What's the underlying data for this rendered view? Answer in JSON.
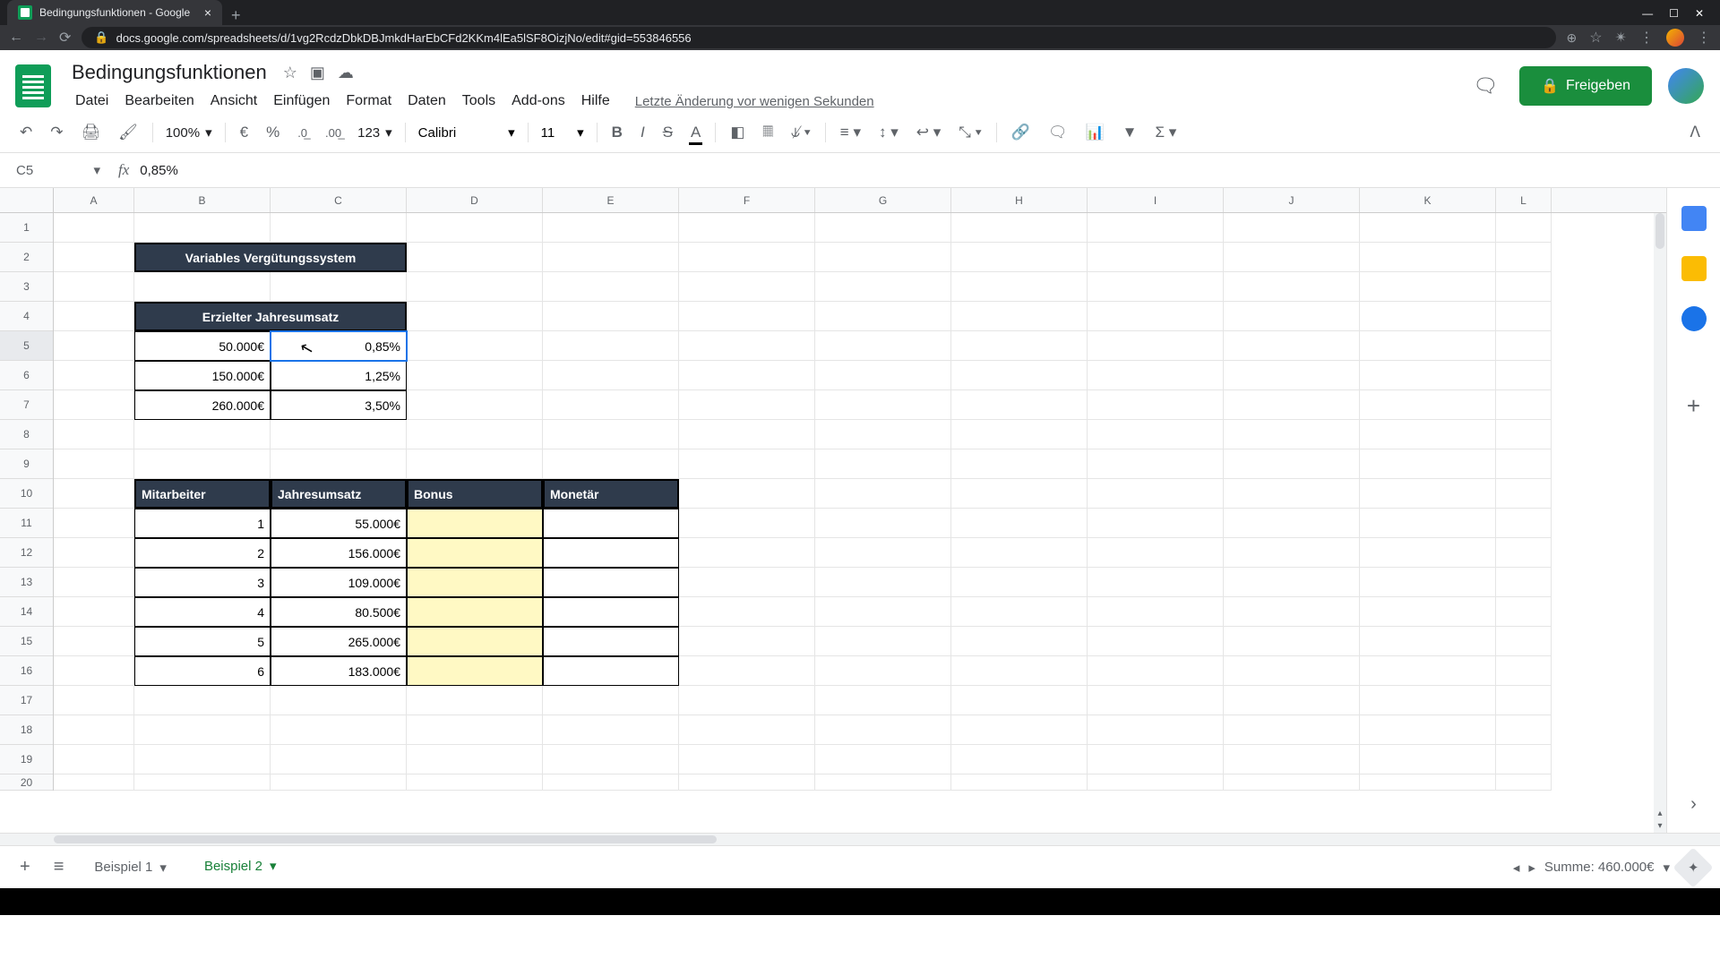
{
  "browser": {
    "tab_title": "Bedingungsfunktionen - Google",
    "url": "docs.google.com/spreadsheets/d/1vg2RcdzDbkDBJmkdHarEbCFd2KKm4lEa5lSF8OizjNo/edit#gid=553846556"
  },
  "doc": {
    "title": "Bedingungsfunktionen",
    "last_edit": "Letzte Änderung vor wenigen Sekunden",
    "share_label": "Freigeben"
  },
  "menu": {
    "file": "Datei",
    "edit": "Bearbeiten",
    "view": "Ansicht",
    "insert": "Einfügen",
    "format": "Format",
    "data": "Daten",
    "tools": "Tools",
    "addons": "Add-ons",
    "help": "Hilfe"
  },
  "toolbar": {
    "zoom": "100%",
    "currency": "€",
    "percent": "%",
    "dec_dec": ".0",
    "inc_dec": ".00",
    "num_format": "123",
    "font": "Calibri",
    "size": "11"
  },
  "formula": {
    "name_box": "C5",
    "value": "0,85%"
  },
  "columns": [
    "A",
    "B",
    "C",
    "D",
    "E",
    "F",
    "G",
    "H",
    "I",
    "J",
    "K",
    "L"
  ],
  "rows": [
    "1",
    "2",
    "3",
    "4",
    "5",
    "6",
    "7",
    "8",
    "9",
    "10",
    "11",
    "12",
    "13",
    "14",
    "15",
    "16",
    "17",
    "18",
    "19",
    "20"
  ],
  "sheet": {
    "B2C2_title": "Variables Vergütungssystem",
    "B4C4_title": "Erzielter Jahresumsatz",
    "tiers": [
      {
        "amount": "50.000€",
        "pct": "0,85%"
      },
      {
        "amount": "150.000€",
        "pct": "1,25%"
      },
      {
        "amount": "260.000€",
        "pct": "3,50%"
      }
    ],
    "emp_headers": {
      "mitarbeiter": "Mitarbeiter",
      "jahresumsatz": "Jahresumsatz",
      "bonus": "Bonus",
      "monetar": "Monetär"
    },
    "employees": [
      {
        "n": "1",
        "rev": "55.000€"
      },
      {
        "n": "2",
        "rev": "156.000€"
      },
      {
        "n": "3",
        "rev": "109.000€"
      },
      {
        "n": "4",
        "rev": "80.500€"
      },
      {
        "n": "5",
        "rev": "265.000€"
      },
      {
        "n": "6",
        "rev": "183.000€"
      }
    ]
  },
  "tabs": {
    "t1": "Beispiel 1",
    "t2": "Beispiel 2"
  },
  "status": {
    "sum": "Summe: 460.000€"
  }
}
